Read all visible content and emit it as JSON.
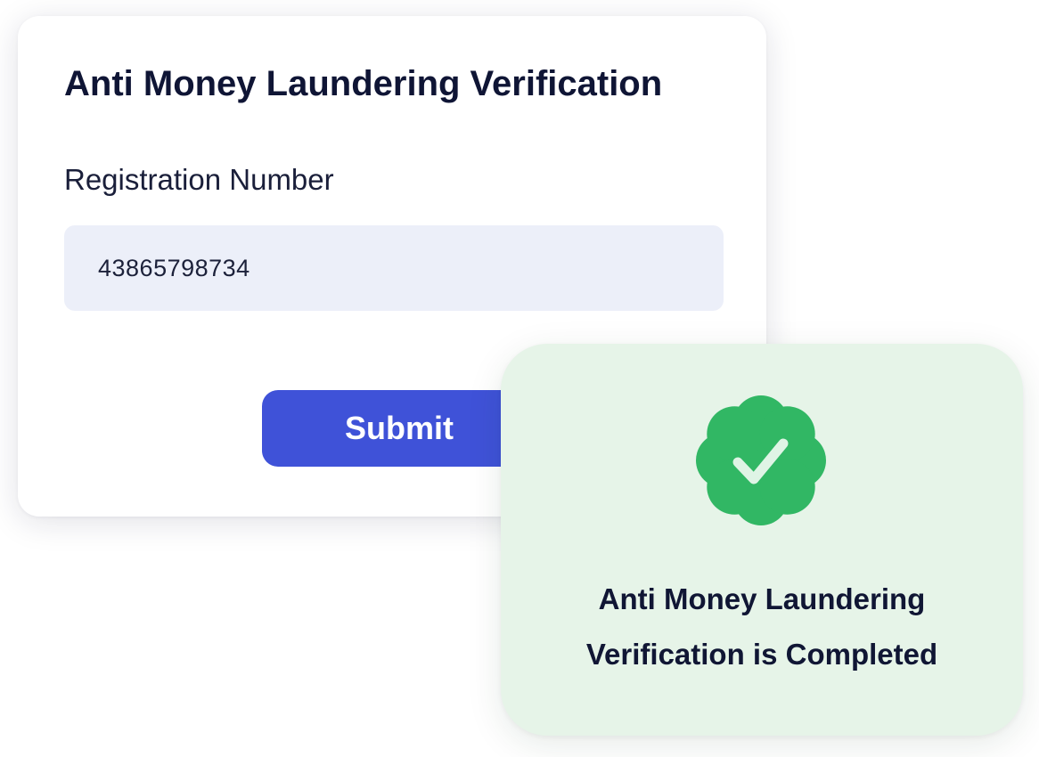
{
  "form": {
    "title": "Anti Money Laundering Verification",
    "registration_label": "Registration Number",
    "registration_value": "43865798734",
    "submit_label": "Submit"
  },
  "status": {
    "line1": "Anti Money Laundering",
    "line2": "Verification is Completed",
    "icon": "verified-check-badge-icon"
  },
  "colors": {
    "accent": "#3f52d8",
    "success": "#31b764",
    "success_background": "#e6f4e8",
    "input_background": "#eceff9"
  }
}
